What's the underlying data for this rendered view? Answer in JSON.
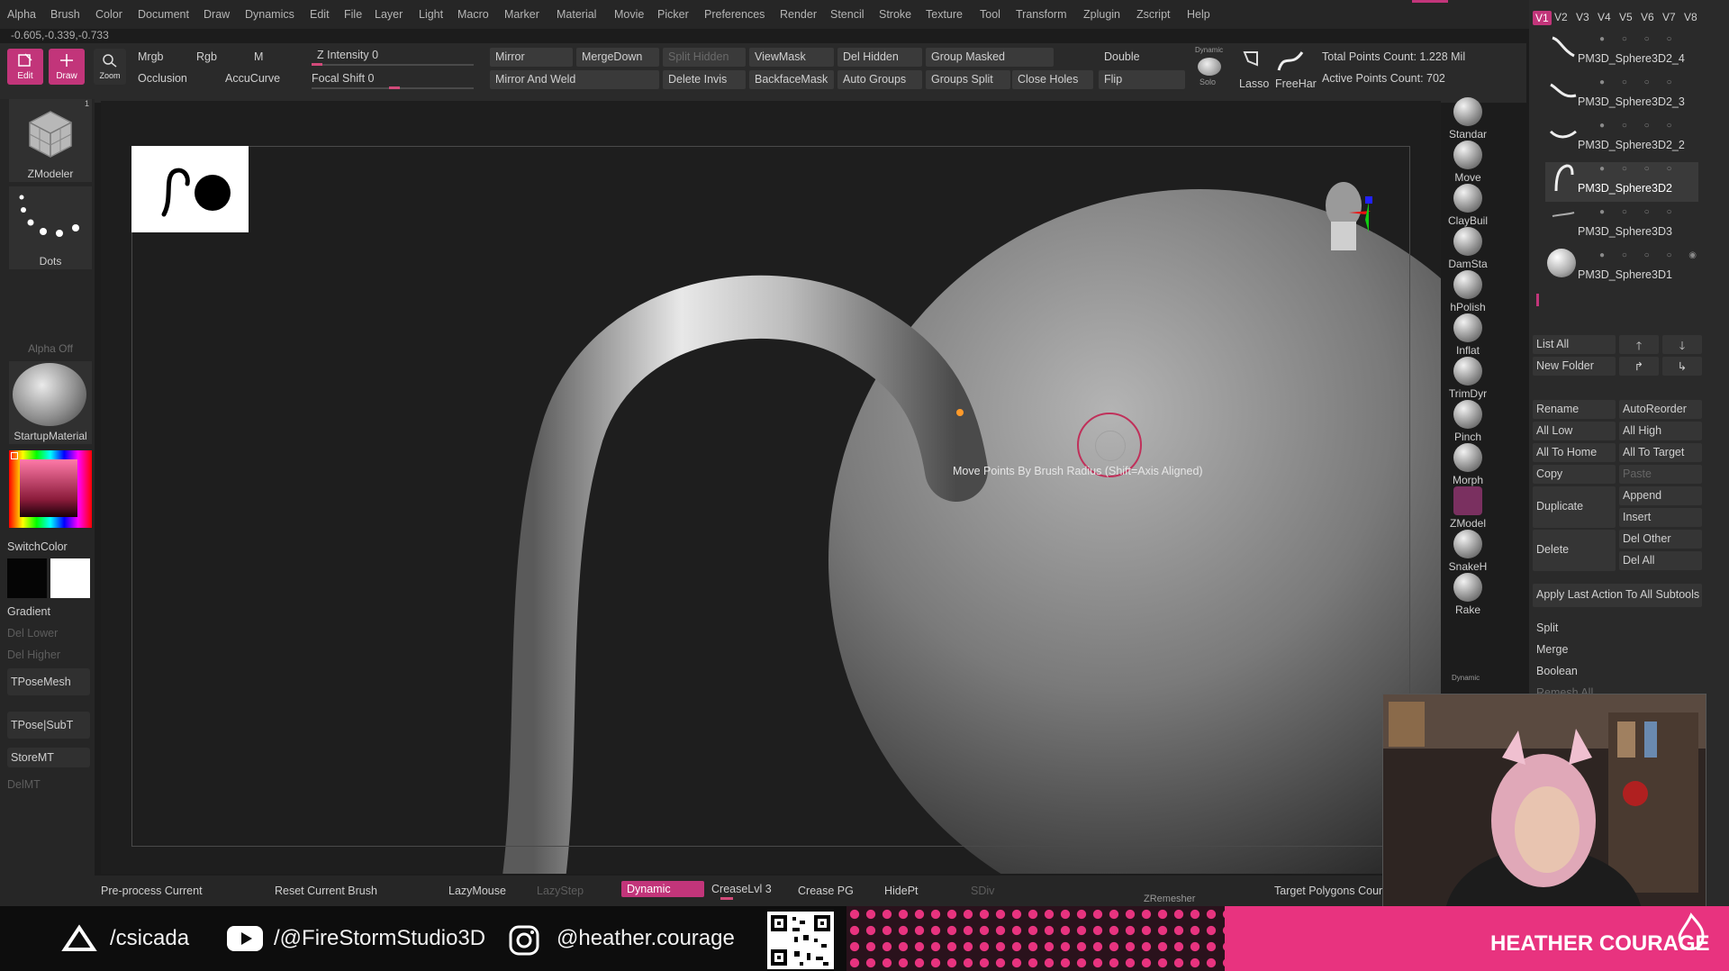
{
  "menu": [
    "Alpha",
    "Brush",
    "Color",
    "Document",
    "Draw",
    "Dynamics",
    "Edit",
    "File",
    "Layer",
    "Light",
    "Macro",
    "Marker",
    "Material",
    "Movie",
    "Picker",
    "Preferences",
    "Render",
    "Stencil",
    "Stroke",
    "Texture",
    "Tool",
    "Transform",
    "Zplugin",
    "Zscript",
    "Help"
  ],
  "coords": "-0.605,-0.339,-0.733",
  "toolbar": {
    "edit": "Edit",
    "draw": "Draw",
    "zoom": "Zoom",
    "mrgb": "Mrgb",
    "rgb": "Rgb",
    "m": "M",
    "occlusion": "Occlusion",
    "accucurve": "AccuCurve",
    "z_intensity": "Z Intensity 0",
    "focal_shift": "Focal Shift 0",
    "mirror": "Mirror",
    "mergedown": "MergeDown",
    "split_hidden": "Split Hidden",
    "mirror_and_weld": "Mirror And Weld",
    "delete_invis": "Delete Invis",
    "viewmask": "ViewMask",
    "backfacemask": "BackfaceMask",
    "del_hidden": "Del Hidden",
    "auto_groups": "Auto Groups",
    "group_masked": "Group Masked",
    "groups_split": "Groups Split",
    "close_holes": "Close Holes",
    "double": "Double",
    "flip": "Flip",
    "dynamic": "Dynamic",
    "solo": "Solo",
    "lasso": "Lasso",
    "freehand": "FreeHar",
    "total_points": "Total Points Count: 1.228 Mil",
    "active_points": "Active Points Count: 702"
  },
  "left": {
    "tool_label": "ZModeler",
    "tool_num": "1",
    "stroke_label": "Dots",
    "alpha_label": "Alpha Off",
    "material_label": "StartupMaterial",
    "switchcolor": "SwitchColor",
    "gradient": "Gradient",
    "del_lower": "Del Lower",
    "del_higher": "Del Higher",
    "tposemesh": "TPoseMesh",
    "tpose_subt": "TPose|SubT",
    "storemt": "StoreMT",
    "delmt": "DelMT"
  },
  "viewport": {
    "tooltip": "Move Points By Brush Radius (Shift=Axis Aligned)"
  },
  "brushes": [
    "Standar",
    "Move",
    "ClayBuil",
    "DamSta",
    "hPolish",
    "Inflat",
    "TrimDyr",
    "Pinch",
    "Morph",
    "ZModel",
    "SnakeH",
    "Rake"
  ],
  "brush_dynamic": "Dynamic",
  "subtool": {
    "vtabs": [
      "V1",
      "V2",
      "V3",
      "V4",
      "V5",
      "V6",
      "V7",
      "V8"
    ],
    "items": [
      {
        "name": "PM3D_Sphere3D2_4"
      },
      {
        "name": "PM3D_Sphere3D2_3"
      },
      {
        "name": "PM3D_Sphere3D2_2"
      },
      {
        "name": "PM3D_Sphere3D2"
      },
      {
        "name": "PM3D_Sphere3D3"
      },
      {
        "name": "PM3D_Sphere3D1"
      }
    ],
    "list_all": "List All",
    "new_folder": "New Folder",
    "rename": "Rename",
    "autoreorder": "AutoReorder",
    "all_low": "All Low",
    "all_high": "All High",
    "all_to_home": "All To Home",
    "all_to_target": "All To Target",
    "copy": "Copy",
    "paste": "Paste",
    "duplicate": "Duplicate",
    "append": "Append",
    "insert": "Insert",
    "delete": "Delete",
    "del_other": "Del Other",
    "del_all": "Del All",
    "apply_last": "Apply Last Action To All Subtools",
    "split": "Split",
    "merge": "Merge",
    "boolean": "Boolean",
    "remesh": "Remesh All"
  },
  "bottom": {
    "preprocess": "Pre-process Current",
    "reset_brush": "Reset Current Brush",
    "lazymouse": "LazyMouse",
    "lazystep": "LazyStep",
    "dynamic": "Dynamic",
    "creaselvl": "CreaseLvl 3",
    "crease_pg": "Crease PG",
    "hidept": "HidePt",
    "sdiv": "SDiv",
    "zremesher": "ZRemesher",
    "target_polys": "Target Polygons Cour"
  },
  "footer": {
    "artstation": "/csicada",
    "youtube": "/@FireStormStudio3D",
    "instagram": "@heather.courage",
    "brand": "HEATHER COURAGE"
  },
  "colors": {
    "accent": "#c2357a",
    "footer_pink": "#e8337f"
  }
}
